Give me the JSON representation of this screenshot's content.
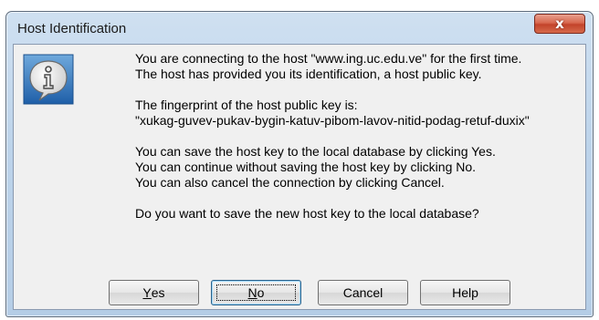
{
  "window": {
    "title": "Host Identification",
    "close_label": "x"
  },
  "icon": {
    "name": "information-icon"
  },
  "message": {
    "lines": [
      "You are connecting to the host \"www.ing.uc.edu.ve\" for the first time.",
      "The host has provided you its identification, a host public key.",
      "The fingerprint of the host public key is:",
      "\"xukag-guvev-pukav-bygin-katuv-pibom-lavov-nitid-podag-retuf-duxix\"",
      "You can save the host key to the local database by clicking Yes.",
      "You can continue without saving the host key by clicking No.",
      "You can also cancel the connection by clicking Cancel.",
      "Do you want to save the new host key to the local database?"
    ]
  },
  "buttons": {
    "yes": {
      "mnemonic": "Y",
      "rest": "es"
    },
    "no": {
      "mnemonic": "N",
      "rest": "o"
    },
    "cancel": "Cancel",
    "help": "Help"
  },
  "colors": {
    "frame": "#bcd3ea",
    "close_button": "#c3432a",
    "client": "#f0f0f0"
  }
}
